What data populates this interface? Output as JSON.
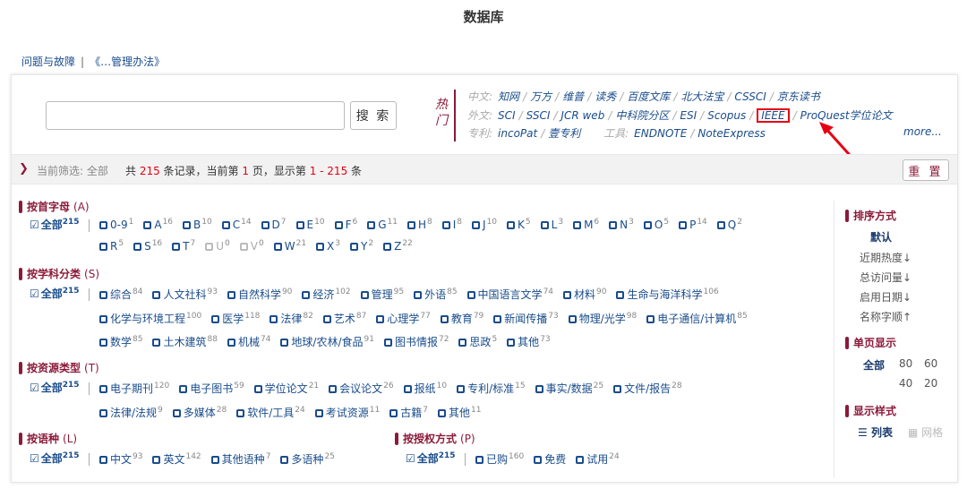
{
  "page_title": "数据库",
  "top_links": [
    "问题与故障",
    "《…管理办法》"
  ],
  "top_links_sep": "|",
  "search": {
    "placeholder": "",
    "button": "搜 索"
  },
  "hot": {
    "label": "热门",
    "zh_label": "中文:",
    "zh": [
      "知网",
      "万方",
      "维普",
      "读秀",
      "百度文库",
      "北大法宝",
      "CSSCI",
      "京东读书"
    ],
    "en_label": "外文:",
    "en": [
      "SCI",
      "SSCI",
      "JCR web",
      "中科院分区",
      "ESI",
      "Scopus",
      "IEEE",
      "ProQuest学位论文"
    ],
    "patent_label": "专利:",
    "patent": [
      "incoPat",
      "壹专利"
    ],
    "tools_label": "工具:",
    "tools": [
      "ENDNOTE",
      "NoteExpress"
    ],
    "more": "more..."
  },
  "filter": {
    "label": "当前筛选:",
    "value": "全部",
    "t1": "共",
    "total": "215",
    "t2": "条记录，当前第",
    "page": "1",
    "t3": "页，显示第",
    "range": "1 - 215",
    "t4": "条",
    "reset": "重 置"
  },
  "sections": {
    "letter": {
      "title": "按首字母",
      "key": "(A)",
      "all": "全部",
      "all_count": "215",
      "row1": [
        [
          "0-9",
          "1"
        ],
        [
          "A",
          "16"
        ],
        [
          "B",
          "10"
        ],
        [
          "C",
          "14"
        ],
        [
          "D",
          "7"
        ],
        [
          "E",
          "10"
        ],
        [
          "F",
          "6"
        ],
        [
          "G",
          "11"
        ],
        [
          "H",
          "8"
        ],
        [
          "I",
          "8"
        ],
        [
          "J",
          "10"
        ],
        [
          "K",
          "5"
        ],
        [
          "L",
          "3"
        ],
        [
          "M",
          "6"
        ],
        [
          "N",
          "3"
        ],
        [
          "O",
          "5"
        ],
        [
          "P",
          "14"
        ],
        [
          "Q",
          "2"
        ]
      ],
      "row2": [
        [
          "R",
          "5"
        ],
        [
          "S",
          "16"
        ],
        [
          "T",
          "7"
        ],
        [
          "U",
          "0"
        ],
        [
          "V",
          "0"
        ],
        [
          "W",
          "21"
        ],
        [
          "X",
          "3"
        ],
        [
          "Y",
          "2"
        ],
        [
          "Z",
          "22"
        ]
      ]
    },
    "subject": {
      "title": "按学科分类",
      "key": "(S)",
      "all": "全部",
      "all_count": "215",
      "row1": [
        [
          "综合",
          "84"
        ],
        [
          "人文社科",
          "93"
        ],
        [
          "自然科学",
          "90"
        ],
        [
          "经济",
          "102"
        ],
        [
          "管理",
          "95"
        ],
        [
          "外语",
          "85"
        ],
        [
          "中国语言文学",
          "74"
        ],
        [
          "材料",
          "90"
        ],
        [
          "生命与海洋科学",
          "106"
        ]
      ],
      "row2": [
        [
          "化学与环境工程",
          "100"
        ],
        [
          "医学",
          "118"
        ],
        [
          "法律",
          "82"
        ],
        [
          "艺术",
          "87"
        ],
        [
          "心理学",
          "77"
        ],
        [
          "教育",
          "79"
        ],
        [
          "新闻传播",
          "73"
        ],
        [
          "物理/光学",
          "98"
        ],
        [
          "电子通信/计算机",
          "85"
        ]
      ],
      "row3": [
        [
          "数学",
          "85"
        ],
        [
          "土木建筑",
          "88"
        ],
        [
          "机械",
          "74"
        ],
        [
          "地球/农林/食品",
          "91"
        ],
        [
          "图书情报",
          "72"
        ],
        [
          "思政",
          "5"
        ],
        [
          "其他",
          "73"
        ]
      ]
    },
    "type": {
      "title": "按资源类型",
      "key": "(T)",
      "all": "全部",
      "all_count": "215",
      "row1": [
        [
          "电子期刊",
          "120"
        ],
        [
          "电子图书",
          "59"
        ],
        [
          "学位论文",
          "21"
        ],
        [
          "会议论文",
          "26"
        ],
        [
          "报纸",
          "10"
        ],
        [
          "专利/标准",
          "15"
        ],
        [
          "事实/数据",
          "25"
        ],
        [
          "文件/报告",
          "28"
        ]
      ],
      "row2": [
        [
          "法律/法规",
          "9"
        ],
        [
          "多媒体",
          "28"
        ],
        [
          "软件/工具",
          "24"
        ],
        [
          "考试资源",
          "11"
        ],
        [
          "古籍",
          "7"
        ],
        [
          "其他",
          "11"
        ]
      ]
    },
    "lang": {
      "title": "按语种",
      "key": "(L)",
      "all": "全部",
      "all_count": "215",
      "row1": [
        [
          "中文",
          "93"
        ],
        [
          "英文",
          "142"
        ],
        [
          "其他语种",
          "7"
        ],
        [
          "多语种",
          "25"
        ]
      ]
    },
    "license": {
      "title": "按授权方式",
      "key": "(P)",
      "all": "全部",
      "all_count": "215",
      "row1": [
        [
          "已购",
          "160"
        ],
        [
          "免费",
          ""
        ],
        [
          "试用",
          "24"
        ]
      ]
    }
  },
  "sidebar": {
    "sort_title": "排序方式",
    "sort": [
      "默认",
      "近期热度↓",
      "总访问量↓",
      "启用日期↓",
      "名称字顺↑"
    ],
    "per_page_title": "单页显示",
    "per_page": [
      "全部",
      "80",
      "60",
      "40",
      "20"
    ],
    "style_title": "显示样式",
    "styles": [
      "列表",
      "网格"
    ]
  },
  "colors": {
    "accent": "#8b1a3a",
    "link": "#1a4c8b",
    "highlight": "#e60012"
  }
}
